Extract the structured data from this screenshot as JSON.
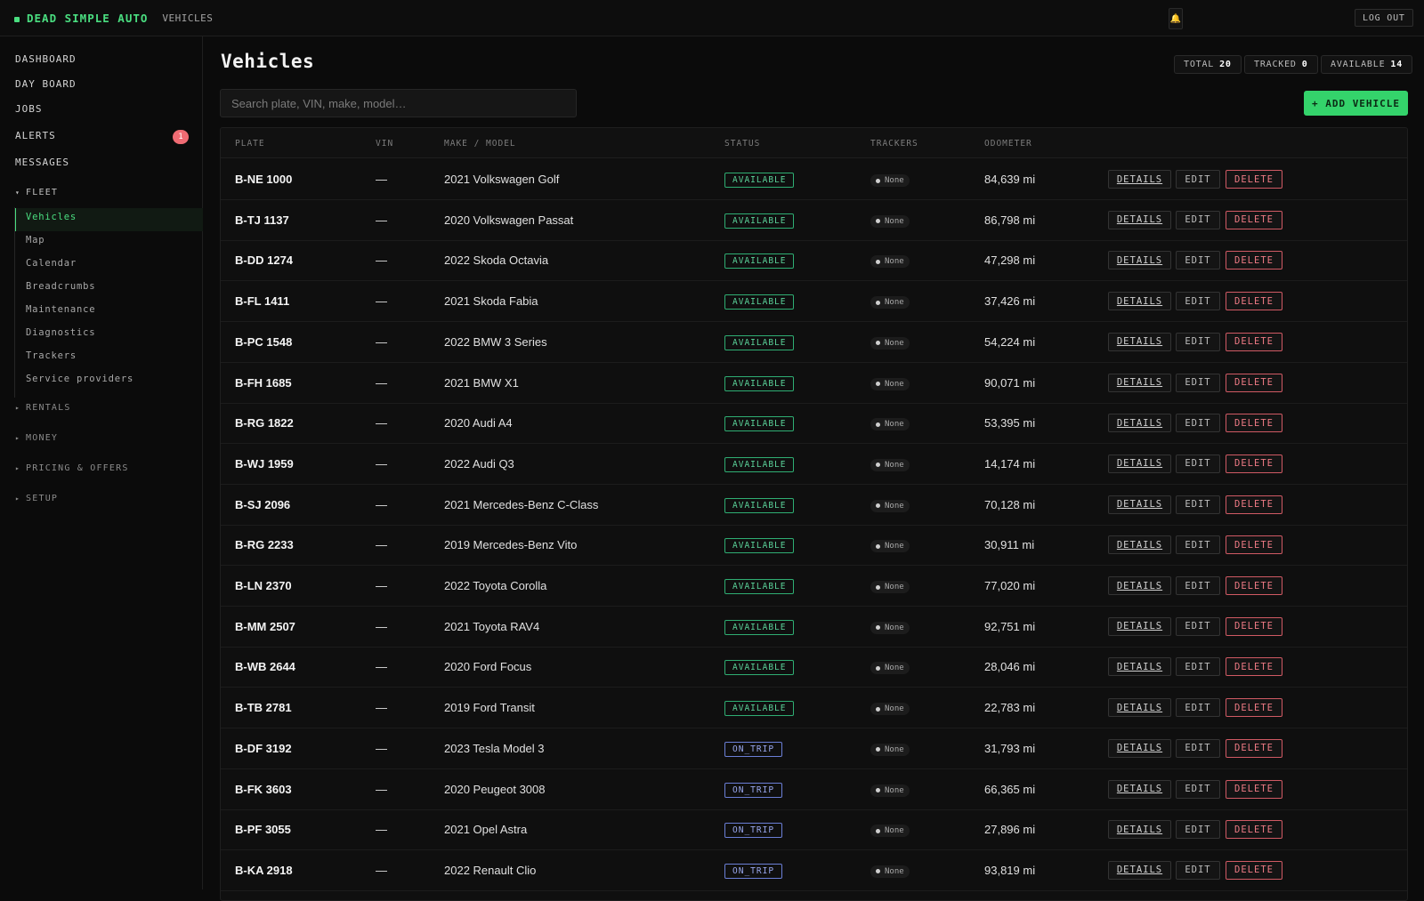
{
  "topbar": {
    "brand": "DEAD SIMPLE AUTO",
    "breadcrumb": "VEHICLES",
    "bell_icon": "bell-icon",
    "logout_label": "LOG OUT"
  },
  "sidebar": {
    "items": [
      {
        "label": "DASHBOARD"
      },
      {
        "label": "DAY BOARD"
      },
      {
        "label": "JOBS"
      },
      {
        "label": "ALERTS",
        "badge": "1"
      },
      {
        "label": "MESSAGES"
      }
    ],
    "fleet": {
      "label": "FLEET",
      "items": [
        "Vehicles",
        "Map",
        "Calendar",
        "Breadcrumbs",
        "Maintenance",
        "Diagnostics",
        "Trackers",
        "Service providers"
      ],
      "active": "Vehicles"
    },
    "sections": [
      "RENTALS",
      "MONEY",
      "PRICING & OFFERS",
      "SETUP"
    ]
  },
  "main": {
    "title": "Vehicles",
    "stats": [
      {
        "label": "TOTAL",
        "value": "20"
      },
      {
        "label": "TRACKED",
        "value": "0"
      },
      {
        "label": "AVAILABLE",
        "value": "14"
      }
    ],
    "search_placeholder": "Search plate, VIN, make, model…",
    "add_label": "+ ADD VEHICLE",
    "columns": [
      "PLATE",
      "VIN",
      "MAKE / MODEL",
      "STATUS",
      "TRACKERS",
      "ODOMETER"
    ],
    "actions": {
      "details": "DETAILS",
      "edit": "EDIT",
      "delete": "DELETE"
    },
    "rows": [
      {
        "plate": "B-NE 1000",
        "vin": "—",
        "model": "2021 Volkswagen Golf",
        "status": "AVAILABLE",
        "trackers": "None",
        "odometer": "84,639 mi"
      },
      {
        "plate": "B-TJ 1137",
        "vin": "—",
        "model": "2020 Volkswagen Passat",
        "status": "AVAILABLE",
        "trackers": "None",
        "odometer": "86,798 mi"
      },
      {
        "plate": "B-DD 1274",
        "vin": "—",
        "model": "2022 Skoda Octavia",
        "status": "AVAILABLE",
        "trackers": "None",
        "odometer": "47,298 mi"
      },
      {
        "plate": "B-FL 1411",
        "vin": "—",
        "model": "2021 Skoda Fabia",
        "status": "AVAILABLE",
        "trackers": "None",
        "odometer": "37,426 mi"
      },
      {
        "plate": "B-PC 1548",
        "vin": "—",
        "model": "2022 BMW 3 Series",
        "status": "AVAILABLE",
        "trackers": "None",
        "odometer": "54,224 mi"
      },
      {
        "plate": "B-FH 1685",
        "vin": "—",
        "model": "2021 BMW X1",
        "status": "AVAILABLE",
        "trackers": "None",
        "odometer": "90,071 mi"
      },
      {
        "plate": "B-RG 1822",
        "vin": "—",
        "model": "2020 Audi A4",
        "status": "AVAILABLE",
        "trackers": "None",
        "odometer": "53,395 mi"
      },
      {
        "plate": "B-WJ 1959",
        "vin": "—",
        "model": "2022 Audi Q3",
        "status": "AVAILABLE",
        "trackers": "None",
        "odometer": "14,174 mi"
      },
      {
        "plate": "B-SJ 2096",
        "vin": "—",
        "model": "2021 Mercedes-Benz C-Class",
        "status": "AVAILABLE",
        "trackers": "None",
        "odometer": "70,128 mi"
      },
      {
        "plate": "B-RG 2233",
        "vin": "—",
        "model": "2019 Mercedes-Benz Vito",
        "status": "AVAILABLE",
        "trackers": "None",
        "odometer": "30,911 mi"
      },
      {
        "plate": "B-LN 2370",
        "vin": "—",
        "model": "2022 Toyota Corolla",
        "status": "AVAILABLE",
        "trackers": "None",
        "odometer": "77,020 mi"
      },
      {
        "plate": "B-MM 2507",
        "vin": "—",
        "model": "2021 Toyota RAV4",
        "status": "AVAILABLE",
        "trackers": "None",
        "odometer": "92,751 mi"
      },
      {
        "plate": "B-WB 2644",
        "vin": "—",
        "model": "2020 Ford Focus",
        "status": "AVAILABLE",
        "trackers": "None",
        "odometer": "28,046 mi"
      },
      {
        "plate": "B-TB 2781",
        "vin": "—",
        "model": "2019 Ford Transit",
        "status": "AVAILABLE",
        "trackers": "None",
        "odometer": "22,783 mi"
      },
      {
        "plate": "B-DF 3192",
        "vin": "—",
        "model": "2023 Tesla Model 3",
        "status": "ON_TRIP",
        "trackers": "None",
        "odometer": "31,793 mi"
      },
      {
        "plate": "B-FK 3603",
        "vin": "—",
        "model": "2020 Peugeot 3008",
        "status": "ON_TRIP",
        "trackers": "None",
        "odometer": "66,365 mi"
      },
      {
        "plate": "B-PF 3055",
        "vin": "—",
        "model": "2021 Opel Astra",
        "status": "ON_TRIP",
        "trackers": "None",
        "odometer": "27,896 mi"
      },
      {
        "plate": "B-KA 2918",
        "vin": "—",
        "model": "2022 Renault Clio",
        "status": "ON_TRIP",
        "trackers": "None",
        "odometer": "93,819 mi"
      }
    ]
  },
  "colors": {
    "accent": "#4ade80",
    "available": "#5bd39a",
    "on_trip": "#9aa8ef",
    "danger": "#ee7a84",
    "background": "#0b0b0b"
  }
}
